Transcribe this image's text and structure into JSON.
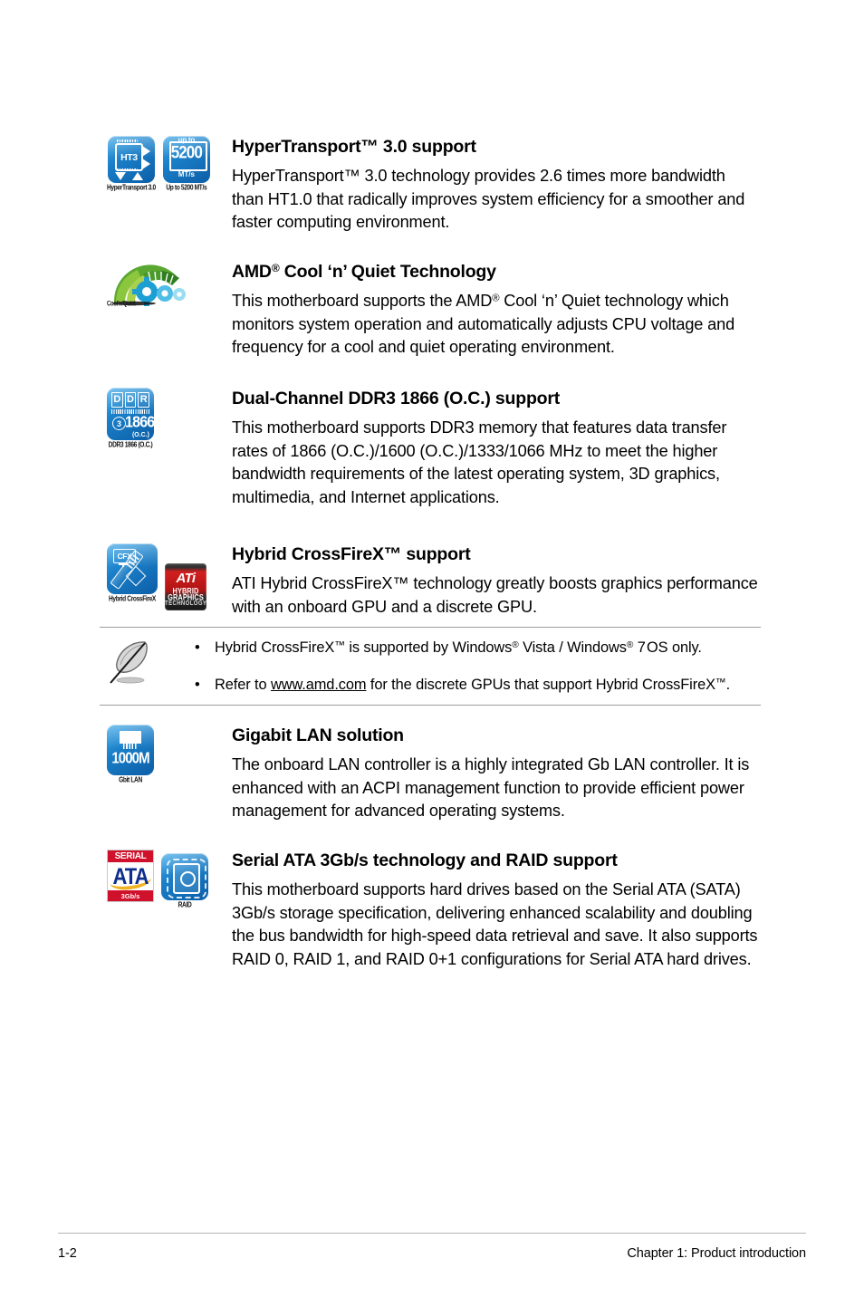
{
  "page": {
    "footer": {
      "page_number": "1-2",
      "chapter": "Chapter 1: Product introduction"
    }
  },
  "features": [
    {
      "id": "hypertransport",
      "title_parts": {
        "pre": "HyperTransport",
        "tm": "™",
        "post": " 3.0 support"
      },
      "title_plain": "HyperTransport™ 3.0 support",
      "body": "HyperTransport™ 3.0 technology provides 2.6 times more bandwidth than HT1.0 that radically improves system efficiency for a smoother and faster computing environment.",
      "icons": [
        {
          "name": "hypertransport-3-icon",
          "caption": "HyperTransport 3.0",
          "chip_label": "HT3"
        },
        {
          "name": "up-to-5200-mts-icon",
          "caption": "Up to 5200 MT/s",
          "upto": "up to",
          "number": "5200",
          "unit": "MT/s"
        }
      ]
    },
    {
      "id": "cool-n-quiet",
      "title_plain": "AMD® Cool ‘n’ Quiet Technology",
      "body": "This motherboard supports the AMD® Cool ‘n’ Quiet technology which monitors system operation and automatically adjusts CPU voltage and frequency for a cool and quiet operating environment.",
      "icons": [
        {
          "name": "cool-n-quiet-icon",
          "caption": "Cool'n'Quiet"
        }
      ]
    },
    {
      "id": "ddr3-1866",
      "title_plain": "Dual-Channel DDR3 1866 (O.C.) support",
      "body": "This motherboard supports DDR3 memory that features data transfer rates of 1866 (O.C.)/1600 (O.C.)/1333/1066 MHz to meet the higher bandwidth requirements of the latest operating system, 3D graphics, multimedia, and Internet applications.",
      "icons": [
        {
          "name": "ddr3-1866-icon",
          "caption": "DDR3 1866 (O.C.)",
          "letters": [
            "D",
            "D",
            "R"
          ],
          "channel": "3",
          "speed": "1866",
          "oc": "(O.C.)"
        }
      ]
    },
    {
      "id": "hybrid-crossfirex",
      "title_plain": "Hybrid CrossFireX™ support",
      "body": "ATI Hybrid CrossFireX™ technology greatly boosts graphics performance with an onboard GPU and a discrete GPU.",
      "icons": [
        {
          "name": "hybrid-crossfirex-icon",
          "caption": "Hybrid CrossFireX",
          "badge": "CFX"
        },
        {
          "name": "ati-hybrid-graphics-icon",
          "caption": "",
          "word": "ATi",
          "line1": "HYBRID",
          "line2": "GRAPHICS",
          "line3": "TECHNOLOGY"
        }
      ]
    },
    {
      "id": "gigabit-lan",
      "title_plain": "Gigabit LAN solution",
      "body": "The onboard LAN controller is a highly integrated Gb LAN controller. It is enhanced with an ACPI management function to provide efficient power management for advanced operating systems.",
      "icons": [
        {
          "name": "gigabit-lan-icon",
          "caption": "Gbit LAN",
          "speed": "1000M"
        }
      ]
    },
    {
      "id": "serial-ata-raid",
      "title_plain": "Serial ATA 3Gb/s technology and RAID support",
      "body": "This motherboard supports hard drives based on the Serial ATA (SATA) 3Gb/s storage specification, delivering enhanced scalability and doubling the bus bandwidth for high-speed data retrieval and save. It also supports RAID 0, RAID 1, and RAID 0+1 configurations for Serial ATA hard drives.",
      "icons": [
        {
          "name": "serial-ata-3gbs-icon",
          "caption": "",
          "top": "SERIAL",
          "mid": "ATA",
          "bottom": "3Gb/s"
        },
        {
          "name": "raid-icon",
          "caption": "RAID"
        }
      ]
    }
  ],
  "note": {
    "icon_name": "note-quill-icon",
    "bullet": "•",
    "items": [
      {
        "text_plain": "Hybrid CrossFireX™ is supported by Windows® Vista / Windows® 7 OS only."
      },
      {
        "text_plain": "Refer to www.amd.com for the discrete GPUs that support Hybrid CrossFireX™.",
        "link": "www.amd.com"
      }
    ]
  }
}
